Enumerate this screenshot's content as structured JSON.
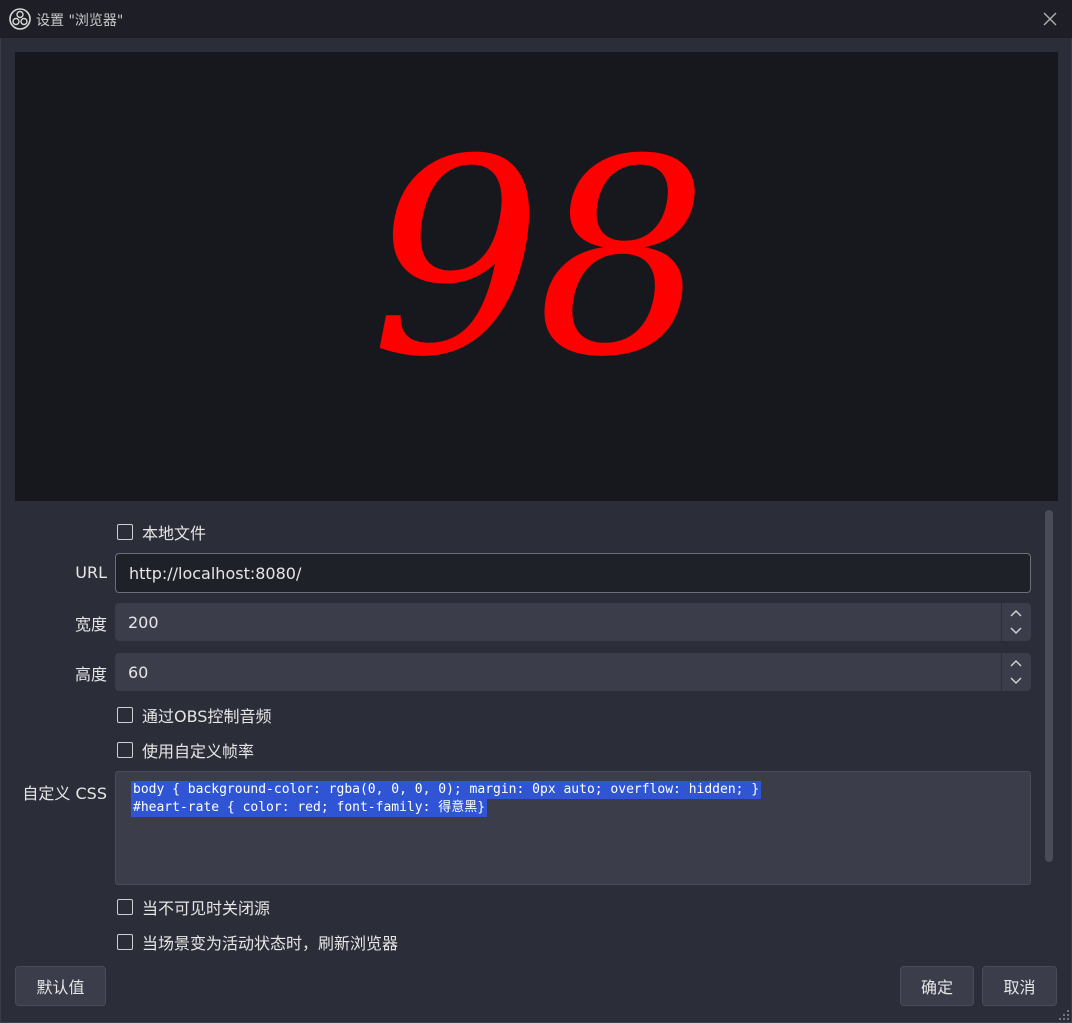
{
  "window": {
    "title": "设置 \"浏览器\"",
    "app_icon": "obs-logo-icon",
    "close_icon": "close-icon"
  },
  "preview": {
    "text": "98",
    "text_color": "#ff0000",
    "background": "#17181d"
  },
  "properties": {
    "local_file": {
      "label": "本地文件",
      "checked": false
    },
    "url": {
      "label": "URL",
      "value": "http://localhost:8080/"
    },
    "width": {
      "label": "宽度",
      "value": "200"
    },
    "height": {
      "label": "高度",
      "value": "60"
    },
    "control_audio": {
      "label": "通过OBS控制音频",
      "checked": false
    },
    "custom_fps": {
      "label": "使用自定义帧率",
      "checked": false
    },
    "custom_css": {
      "label": "自定义 CSS",
      "lines": [
        "body { background-color: rgba(0, 0, 0, 0); margin: 0px auto; overflow: hidden; }",
        "#heart-rate { color: red; font-family: 得意黑}"
      ],
      "selection_color": "#2f55d4"
    },
    "shutdown_when_hidden": {
      "label": "当不可见时关闭源",
      "checked": false
    },
    "refresh_on_active": {
      "label": "当场景变为活动状态时，刷新浏览器",
      "checked": false
    }
  },
  "buttons": {
    "defaults": "默认值",
    "ok": "确定",
    "cancel": "取消"
  }
}
